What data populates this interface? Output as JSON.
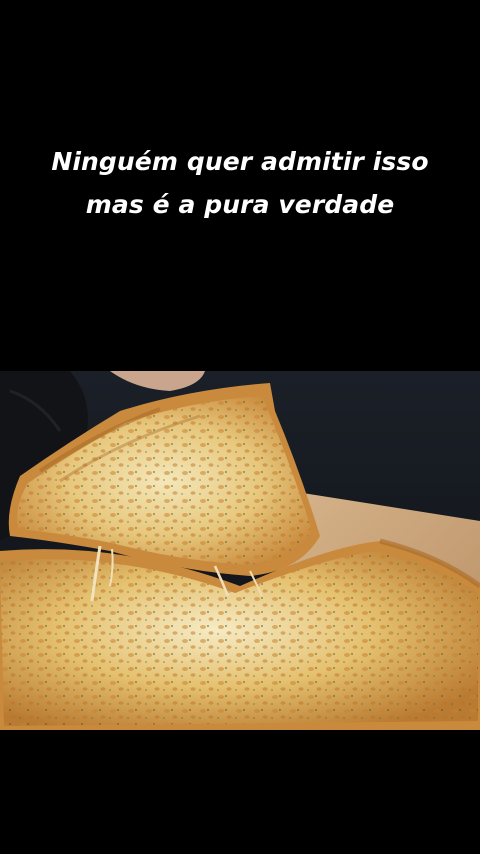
{
  "caption": {
    "line1": "Ninguém quer admitir isso",
    "line2": "mas é a pura verdade"
  },
  "photo": {
    "subject": "cheese pizza slice being lifted",
    "colors": {
      "background_top": "#1a1e25",
      "cheese_light": "#f3e6b8",
      "cheese_golden": "#d9a94e",
      "crust": "#c98b3f",
      "board": "#c9a27a",
      "glove": "#121316"
    }
  }
}
